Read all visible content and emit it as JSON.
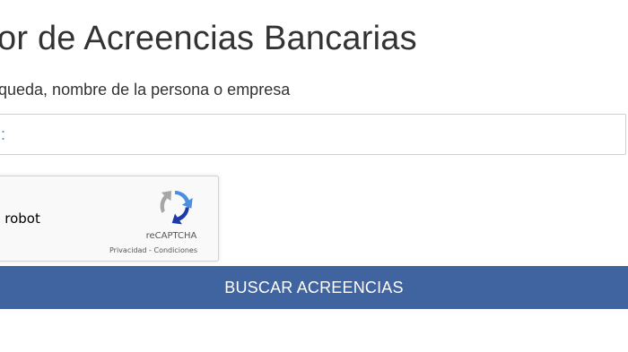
{
  "header": {
    "title": "or de Acreencias Bancarias",
    "subtitle": "queda, nombre de la persona o empresa"
  },
  "search": {
    "value": ":"
  },
  "recaptcha": {
    "checkbox_label": "n robot",
    "brand": "reCAPTCHA",
    "privacy_link": "Privacidad",
    "separator": " - ",
    "terms_link": "Condiciones"
  },
  "actions": {
    "search_button_label": "BUSCAR ACREENCIAS"
  },
  "colors": {
    "button_bg": "#3f64a0",
    "button_text": "#ffffff",
    "input_text": "#4a90d9"
  }
}
